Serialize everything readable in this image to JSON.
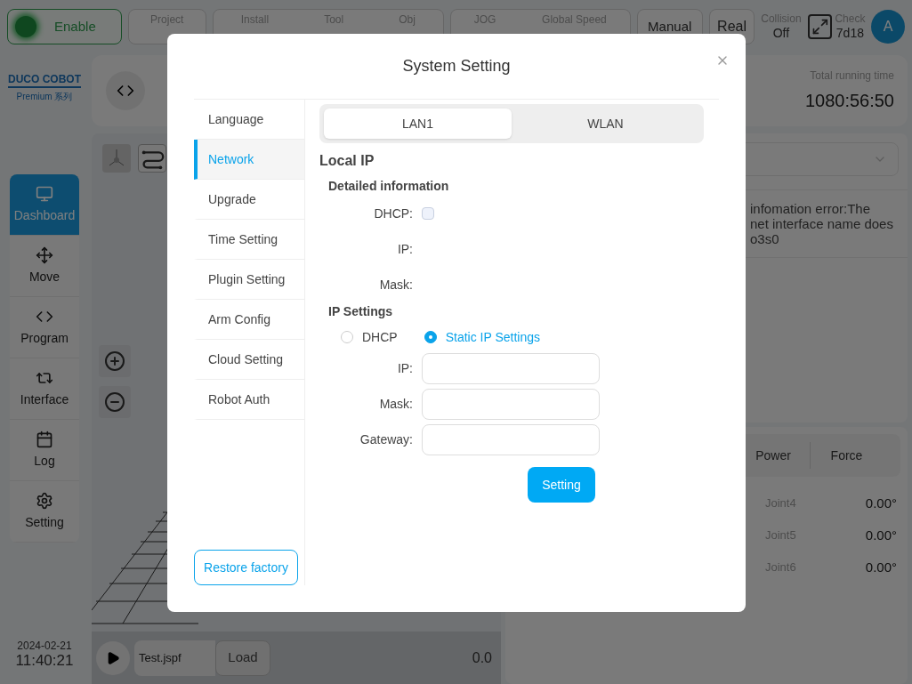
{
  "top_bar": {
    "enable_button": {
      "label": "Enable",
      "on": true
    },
    "project": {
      "label": "Project"
    },
    "robot_config": [
      {
        "label": "Install"
      },
      {
        "label": "Tool"
      },
      {
        "label": "Obj"
      }
    ],
    "speed": [
      {
        "label": "JOG"
      },
      {
        "label": "Global Speed"
      }
    ],
    "mode_button": "Manual",
    "real_button": "Real",
    "collision": {
      "label": "Collision",
      "value": "Off"
    },
    "check": {
      "label": "Check",
      "value": "7d18"
    },
    "avatar": "A"
  },
  "sidebar": {
    "logo": {
      "brand": "DUCO COBOT",
      "subtitle": "Premium 系列"
    },
    "nav": [
      {
        "label": "Dashboard",
        "selected": true
      },
      {
        "label": "Move",
        "selected": false
      },
      {
        "label": "Program",
        "selected": false
      },
      {
        "label": "Interface",
        "selected": false
      },
      {
        "label": "Log",
        "selected": false
      },
      {
        "label": "Setting",
        "selected": false
      }
    ],
    "date": "2024-02-21",
    "time": "11:40:21"
  },
  "program_bar": {
    "file": "Test.jspf",
    "load_button": "Load",
    "value": "0.0"
  },
  "running_time": {
    "label": "Total running time",
    "value": "1080:56:50"
  },
  "log_message": [
    "infomation error:The",
    "net interface name does",
    "o3s0"
  ],
  "joint_panel": {
    "tabs": [
      {
        "label": "Power"
      },
      {
        "label": "Force"
      }
    ],
    "joints": [
      {
        "name": "Joint4",
        "value": "0.00°"
      },
      {
        "name": "Joint5",
        "value": "0.00°"
      },
      {
        "name": "Joint6",
        "value": "0.00°"
      }
    ]
  },
  "dialog": {
    "title": "System Setting",
    "menu": [
      {
        "label": "Language",
        "selected": false
      },
      {
        "label": "Network",
        "selected": true
      },
      {
        "label": "Upgrade",
        "selected": false
      },
      {
        "label": "Time Setting",
        "selected": false
      },
      {
        "label": "Plugin Setting",
        "selected": false
      },
      {
        "label": "Arm Config",
        "selected": false
      },
      {
        "label": "Cloud Setting",
        "selected": false
      },
      {
        "label": "Robot Auth",
        "selected": false
      }
    ],
    "restore_button": "Restore factory",
    "tabs": [
      {
        "label": "LAN1",
        "selected": true
      },
      {
        "label": "WLAN",
        "selected": false
      }
    ],
    "section_title": "Local IP",
    "detail_heading": "Detailed information",
    "dhcp": {
      "label": "DHCP:",
      "checked": false
    },
    "detail_rows": [
      "IP:",
      "Mask:"
    ],
    "ip_heading": "IP Settings",
    "modes": [
      {
        "label": "DHCP",
        "selected": false
      },
      {
        "label": "Static IP Settings",
        "selected": true
      }
    ],
    "fields": [
      {
        "label": "IP:"
      },
      {
        "label": "Mask:"
      },
      {
        "label": "Gateway:"
      }
    ],
    "setting_button": "Setting"
  }
}
